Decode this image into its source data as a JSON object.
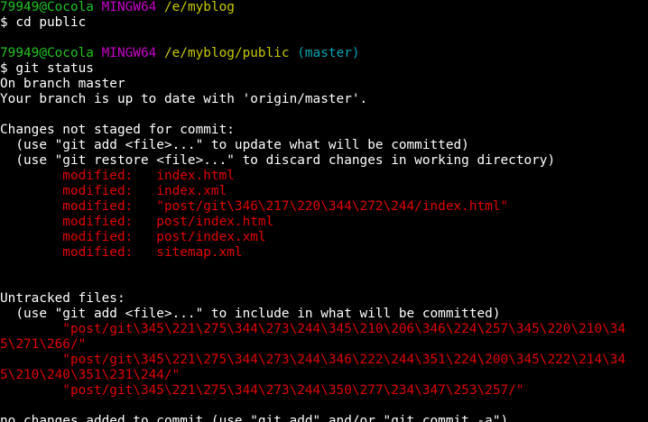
{
  "prompt1": {
    "user": "79949@Cocola",
    "system": "MINGW64",
    "path": "/e/myblog"
  },
  "cmd1": "$ cd public",
  "prompt2": {
    "user": "79949@Cocola",
    "system": "MINGW64",
    "path": "/e/myblog/public",
    "branch": "(master)"
  },
  "cmd2": "$ git status",
  "status": {
    "on_branch": "On branch master",
    "up_to_date": "Your branch is up to date with 'origin/master'.",
    "not_staged_header": "Changes not staged for commit:",
    "hint_add": "  (use \"git add <file>...\" to update what will be committed)",
    "hint_restore": "  (use \"git restore <file>...\" to discard changes in working directory)",
    "modified": [
      "        modified:   index.html",
      "        modified:   index.xml",
      "        modified:   \"post/git\\346\\217\\220\\344\\272\\244/index.html\"",
      "        modified:   post/index.html",
      "        modified:   post/index.xml",
      "        modified:   sitemap.xml"
    ],
    "untracked_header": "Untracked files:",
    "hint_untracked": "  (use \"git add <file>...\" to include in what will be committed)",
    "untracked": [
      "        \"post/git\\345\\221\\275\\344\\273\\244\\345\\210\\206\\346\\224\\257\\345\\220\\210\\34",
      "5\\271\\266/\"",
      "        \"post/git\\345\\221\\275\\344\\273\\244\\346\\222\\244\\351\\224\\200\\345\\222\\214\\34",
      "5\\210\\240\\351\\231\\244/\"",
      "        \"post/git\\345\\221\\275\\344\\273\\244\\350\\277\\234\\347\\253\\257/\""
    ],
    "summary": "no changes added to commit (use \"git add\" and/or \"git commit -a\")"
  },
  "colors": {
    "background": "#000000",
    "text": "#ffffff",
    "prompt_user": "#22c222",
    "prompt_system": "#c800c8",
    "prompt_path": "#c8c800",
    "prompt_branch": "#00a6b2",
    "changes": "#e00000"
  }
}
